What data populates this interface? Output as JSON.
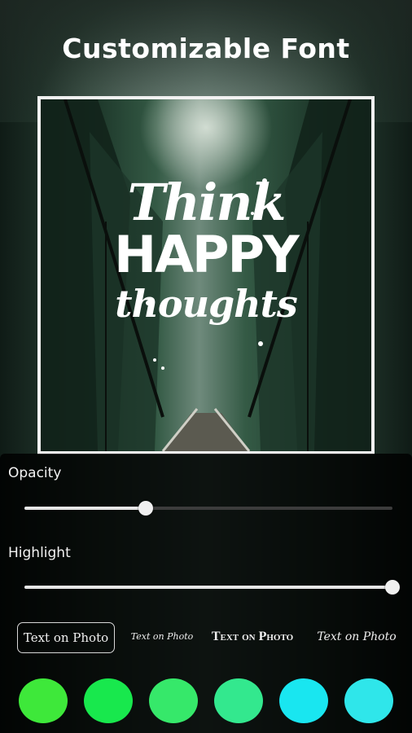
{
  "title": "Customizable Font",
  "quote": {
    "line1": "Think",
    "line2": "HAPPY",
    "line3": "thoughts"
  },
  "opacity": {
    "label": "Opacity",
    "value": 0.33
  },
  "highlight": {
    "label": "Highlight",
    "value": 1.0
  },
  "font_options": [
    {
      "label": "Text on Photo",
      "selected": true
    },
    {
      "label": "Text on Photo",
      "selected": false
    },
    {
      "label": "Text on Photo",
      "selected": false
    },
    {
      "label": "Text on Photo",
      "selected": false
    }
  ],
  "color_swatches": [
    "#3ee83a",
    "#18e84d",
    "#36e86a",
    "#33e88e",
    "#19e6f0",
    "#2fe6ea"
  ]
}
